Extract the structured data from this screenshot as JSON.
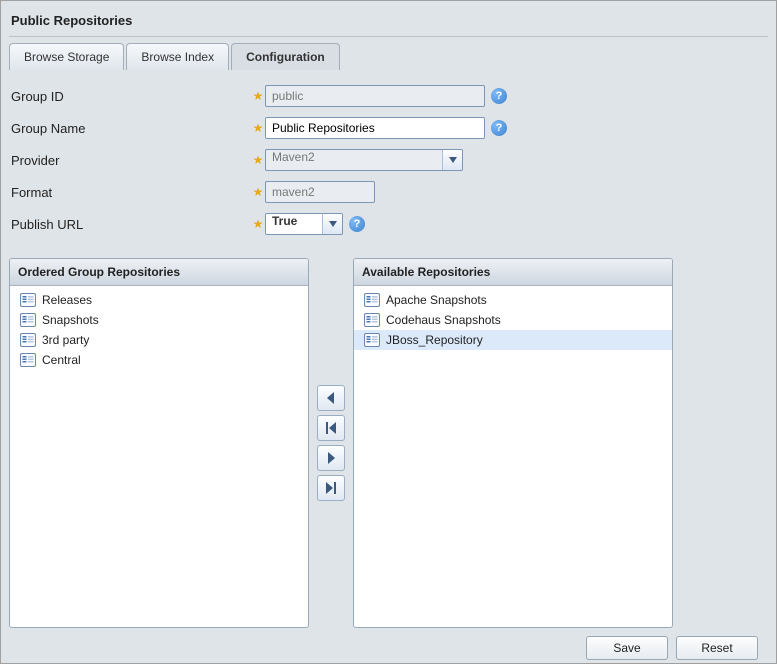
{
  "panel": {
    "title": "Public Repositories"
  },
  "tabs": {
    "browse_storage": "Browse Storage",
    "browse_index": "Browse Index",
    "configuration": "Configuration"
  },
  "form": {
    "group_id": {
      "label": "Group ID",
      "value": "public"
    },
    "group_name": {
      "label": "Group Name",
      "value": "Public Repositories"
    },
    "provider": {
      "label": "Provider",
      "value": "Maven2"
    },
    "format": {
      "label": "Format",
      "value": "maven2"
    },
    "publish_url": {
      "label": "Publish URL",
      "value": "True"
    }
  },
  "lists": {
    "ordered_title": "Ordered Group Repositories",
    "available_title": "Available Repositories",
    "ordered": [
      "Releases",
      "Snapshots",
      "3rd party",
      "Central"
    ],
    "available": [
      "Apache Snapshots",
      "Codehaus Snapshots",
      "JBoss_Repository"
    ],
    "selected_available_index": 2
  },
  "buttons": {
    "save": "Save",
    "reset": "Reset"
  }
}
